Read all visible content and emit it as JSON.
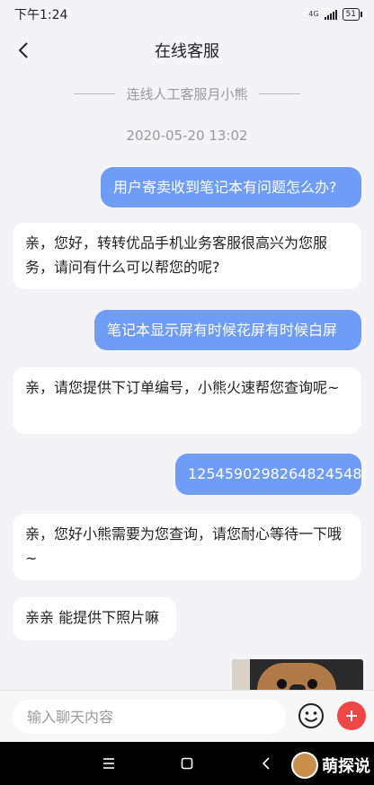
{
  "status_bar": {
    "time": "下午1:24",
    "network": "4G",
    "battery": "51"
  },
  "header": {
    "title": "在线客服"
  },
  "chat": {
    "connect_notice": "连线人工客服月小熊",
    "timestamp": "2020-05-20 13:02",
    "messages": [
      {
        "side": "out",
        "text": "用户寄卖收到笔记本有问题怎么办?"
      },
      {
        "side": "in",
        "text": "亲，您好，转转优品手机业务客服很高兴为您服务，请问有什么可以帮您的呢?"
      },
      {
        "side": "out",
        "text": "笔记本显示屏有时候花屏有时候白屏"
      },
      {
        "side": "in",
        "text": "亲，请您提供下订单编号，小熊火速帮您查询呢~"
      },
      {
        "side": "out",
        "text": "1254590298264824548"
      },
      {
        "side": "in",
        "text": "亲，您好小熊需要为您查询，请您耐心等待一下哦~"
      },
      {
        "side": "in",
        "text": "亲亲 能提供下照片嘛"
      }
    ]
  },
  "input": {
    "placeholder": "输入聊天内容"
  },
  "watermark": {
    "text": "萌探说"
  },
  "colors": {
    "outgoing_bubble": "#6f9df5",
    "incoming_bubble": "#ffffff",
    "plus_button": "#ee4747"
  }
}
